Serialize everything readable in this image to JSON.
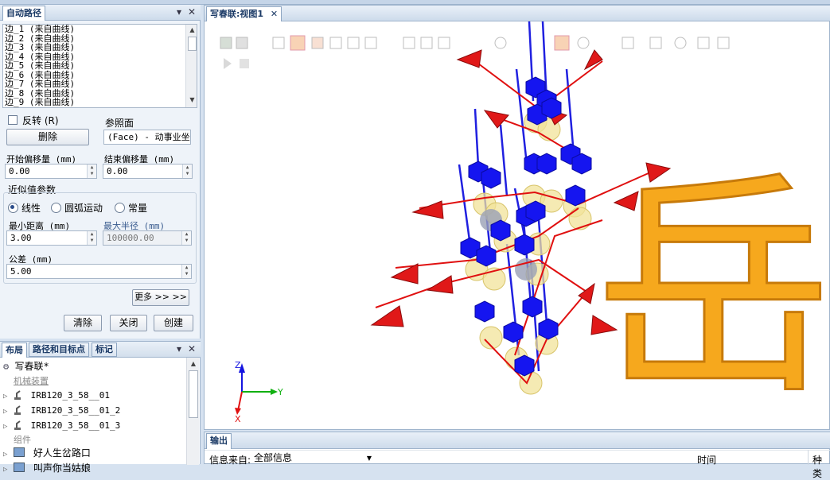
{
  "autopath": {
    "title": "自动路径",
    "edges": [
      "边_1 (来自曲线)",
      "边_2 (来自曲线)",
      "边_3 (来自曲线)",
      "边_4 (来自曲线)",
      "边_5 (来自曲线)",
      "边_6 (来自曲线)",
      "边_7 (来自曲线)",
      "边_8 (来自曲线)",
      "边_9 (来自曲线)"
    ],
    "reverse_label": "反转 (R)",
    "delete_label": "删除",
    "ref_plane_label": "参照面",
    "ref_plane_value": "(Face) - 动事业坐",
    "start_offset_label": "开始偏移量 (mm)",
    "start_offset_value": "0.00",
    "end_offset_label": "结束偏移量 (mm)",
    "end_offset_value": "0.00",
    "approx_group_label": "近似值参数",
    "mode_linear": "线性",
    "mode_arc": "圆弧运动",
    "mode_const": "常量",
    "min_dist_label": "最小距离 (mm)",
    "min_dist_value": "3.00",
    "max_radius_label": "最大半径 (mm)",
    "max_radius_value": "100000.00",
    "tolerance_label": "公差 (mm)",
    "tolerance_value": "5.00",
    "more_label": "更多 >> >>",
    "clear_label": "清除",
    "close_label": "关闭",
    "create_label": "创建"
  },
  "layout": {
    "tabs": [
      "布局",
      "路径和目标点",
      "标记"
    ],
    "station": "写春联*",
    "mech_group": "机械装置",
    "robots": [
      "IRB120_3_58__01",
      "IRB120_3_58__01_2",
      "IRB120_3_58__01_3"
    ],
    "components_group": "组件",
    "component_1": "好人生岔路口",
    "component_2": "叫声你当姑娘"
  },
  "viewport": {
    "tab_label": "写春联:视图1",
    "character": "岳",
    "axis_z": "Z",
    "axis_y": "Y",
    "axis_x": "X"
  },
  "output": {
    "title": "输出",
    "info_from_label": "信息来自:",
    "info_from_value": "全部信息",
    "col_time": "时间",
    "col_type": "种类"
  }
}
